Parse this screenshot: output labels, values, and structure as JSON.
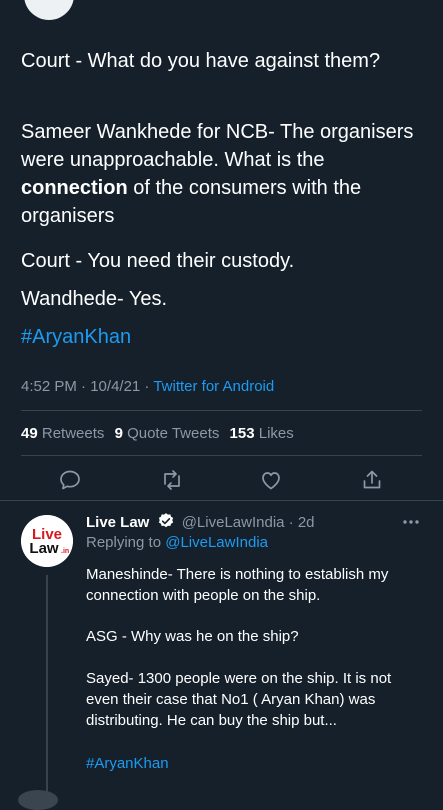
{
  "tweet": {
    "paragraphs": [
      "Court - What do you have against them?",
      "Court - You need their custody.",
      "Wandhede- Yes."
    ],
    "p2_before": "Sameer Wankhede for NCB- The organisers were unapproachable. What is the ",
    "p2_bold": "connection",
    "p2_after": " of the consumers with the organisers",
    "hashtag": "#AryanKhan",
    "time": "4:52 PM",
    "date": "10/4/21",
    "source": "Twitter for Android",
    "sep": " · "
  },
  "stats": {
    "retweets_count": "49",
    "retweets_label": "Retweets",
    "quotes_count": "9",
    "quotes_label": "Quote Tweets",
    "likes_count": "153",
    "likes_label": "Likes"
  },
  "actions": [
    "reply-icon",
    "retweet-icon",
    "like-icon",
    "share-icon"
  ],
  "reply": {
    "avatar_line1": "Live",
    "avatar_line2": "Law",
    "avatar_suffix": ".in",
    "name": "Live Law",
    "handle": "@LiveLawIndia",
    "age": "2d",
    "replying_prefix": "Replying to",
    "replying_to": "@LiveLawIndia",
    "paragraphs": [
      "Maneshinde- There is nothing to establish my connection with people on the ship.",
      "ASG - Why was he on the ship?",
      "Sayed- 1300 people were on the ship. It is not even their case that No1 ( Aryan Khan) was distributing. He can buy the ship but..."
    ],
    "hashtag": "#AryanKhan"
  },
  "colors": {
    "background": "#15202b",
    "accent": "#1d9bf0",
    "muted": "#8b98a5",
    "divider": "#38444d",
    "brand_red": "#d71920"
  }
}
